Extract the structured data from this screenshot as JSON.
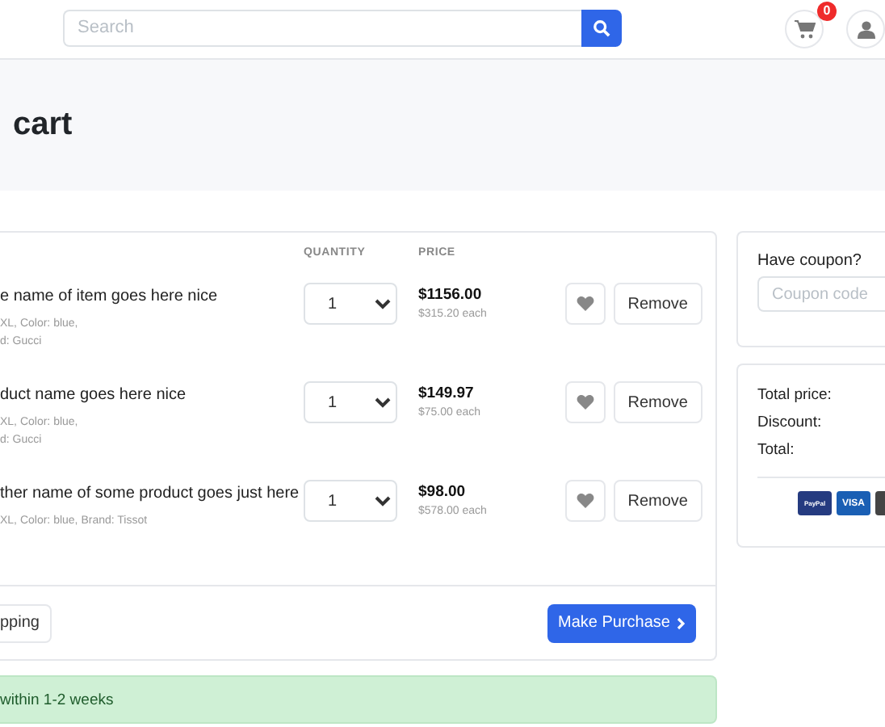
{
  "header": {
    "search": {
      "placeholder": "Search"
    },
    "cart_badge": "0"
  },
  "page_title": "cart",
  "table": {
    "columns": [
      "QUANTITY",
      "PRICE"
    ],
    "rows": [
      {
        "name": "e name of item goes here nice",
        "details": [
          "XL, Color: blue,",
          "d: Gucci"
        ],
        "quantity": "1",
        "price": "$1156.00",
        "unit_price": "$315.20 each",
        "remove": "Remove"
      },
      {
        "name": "duct name goes here nice",
        "details": [
          "XL, Color: blue,",
          "d: Gucci"
        ],
        "quantity": "1",
        "price": "$149.97",
        "unit_price": "$75.00 each",
        "remove": "Remove"
      },
      {
        "name": "ther name of some product goes just here",
        "details": [
          "XL, Color: blue, Brand: Tissot"
        ],
        "quantity": "1",
        "price": "$98.00",
        "unit_price": "$578.00 each",
        "remove": "Remove"
      }
    ]
  },
  "footer": {
    "continue_button": "pping",
    "purchase_button": "Make Purchase"
  },
  "alert": "within 1-2 weeks",
  "coupon": {
    "label": "Have coupon?",
    "placeholder": "Coupon code"
  },
  "totals": {
    "labels": [
      "Total price:",
      "Discount:",
      "Total:"
    ],
    "payment_methods": [
      {
        "kind": "paypal",
        "label": "PayPal"
      },
      {
        "kind": "visa",
        "label": "VISA"
      },
      {
        "kind": "mastercard"
      }
    ]
  }
}
